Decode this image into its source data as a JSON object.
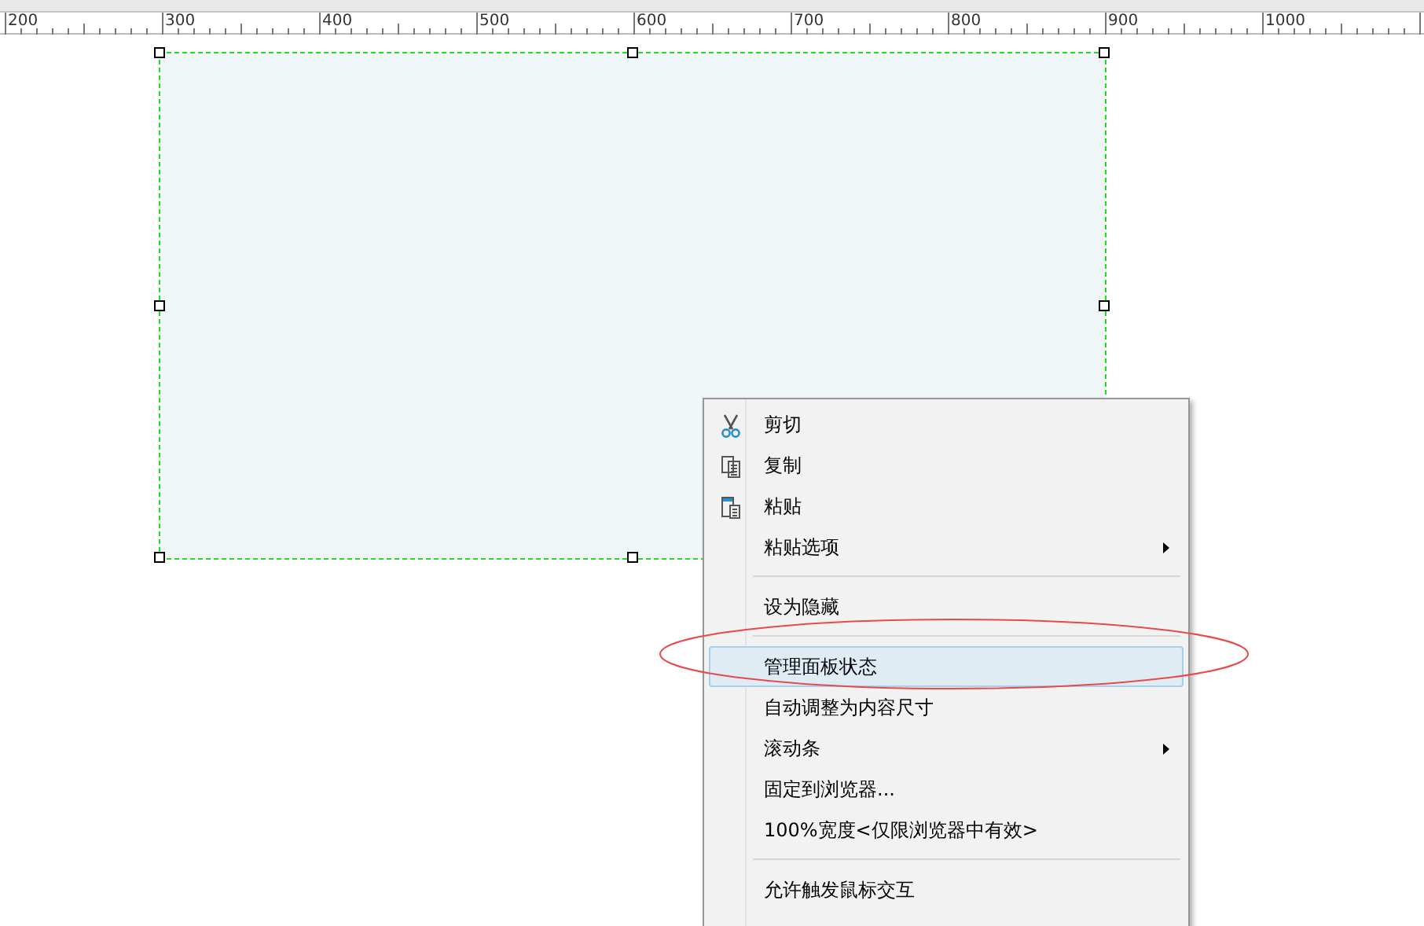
{
  "ruler": {
    "labels": [
      "200",
      "300",
      "400",
      "500",
      "600",
      "700",
      "800",
      "900",
      "1000"
    ]
  },
  "panel": {
    "selected": true
  },
  "context_menu": {
    "items": [
      {
        "kind": "cut",
        "label": "剪切",
        "submenu": false,
        "selected": false
      },
      {
        "kind": "copy",
        "label": "复制",
        "submenu": false,
        "selected": false
      },
      {
        "kind": "paste",
        "label": "粘贴",
        "submenu": false,
        "selected": false
      },
      {
        "kind": "item",
        "label": "粘贴选项",
        "submenu": true,
        "selected": false
      },
      {
        "kind": "separator"
      },
      {
        "kind": "item",
        "label": "设为隐藏",
        "submenu": false,
        "selected": false
      },
      {
        "kind": "separator"
      },
      {
        "kind": "item",
        "label": "管理面板状态",
        "submenu": false,
        "selected": true
      },
      {
        "kind": "item",
        "label": "自动调整为内容尺寸",
        "submenu": false,
        "selected": false
      },
      {
        "kind": "item",
        "label": "滚动条",
        "submenu": true,
        "selected": false
      },
      {
        "kind": "item",
        "label": "固定到浏览器...",
        "submenu": false,
        "selected": false
      },
      {
        "kind": "item",
        "label": "100%宽度<仅限浏览器中有效>",
        "submenu": false,
        "selected": false
      },
      {
        "kind": "separator"
      },
      {
        "kind": "item",
        "label": "允许触发鼠标交互",
        "submenu": false,
        "selected": false
      }
    ]
  },
  "annotation": {
    "kind": "ellipse",
    "color": "#e8494b"
  }
}
